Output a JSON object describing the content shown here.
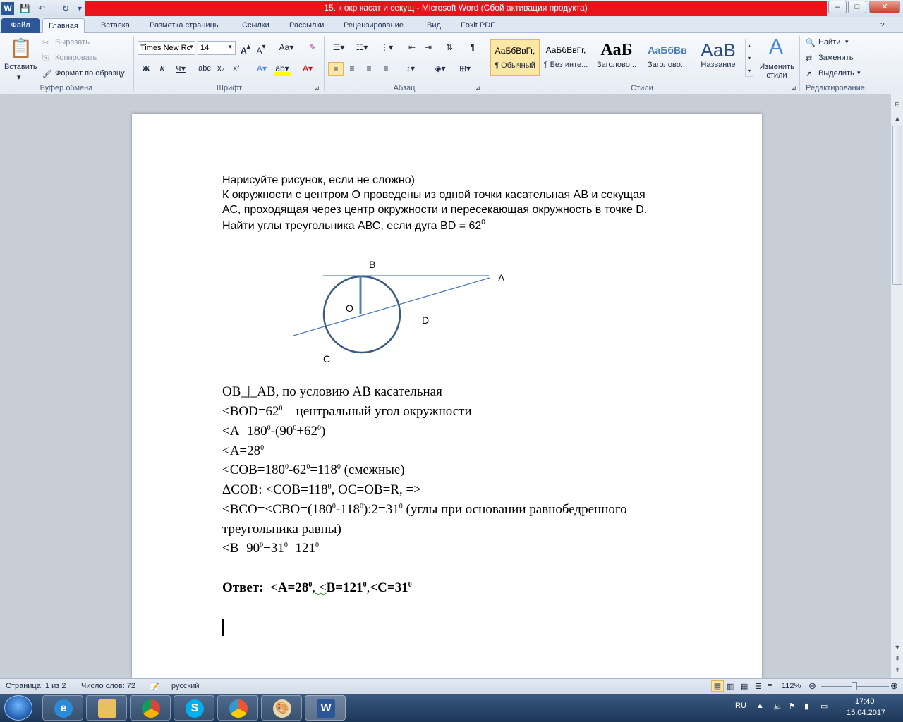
{
  "titlebar": {
    "title": "15. к окр касат и секущ  -  Microsoft Word (Сбой активации продукта)",
    "minimize": "–",
    "maximize": "□",
    "close": "✕"
  },
  "tabs": [
    "Файл",
    "Главная",
    "Вставка",
    "Разметка страницы",
    "Ссылки",
    "Рассылки",
    "Рецензирование",
    "Вид",
    "Foxit PDF"
  ],
  "ribbon": {
    "clipboard": {
      "paste": "Вставить",
      "cut": "Вырезать",
      "copy": "Копировать",
      "format_painter": "Формат по образцу",
      "label": "Буфер обмена"
    },
    "font": {
      "family": "Times New Rc",
      "size": "14",
      "label": "Шрифт"
    },
    "paragraph": {
      "label": "Абзац"
    },
    "styles": {
      "items": [
        {
          "sample": "АаБбВвГг,",
          "name": "¶ Обычный"
        },
        {
          "sample": "АаБбВвГг,",
          "name": "¶ Без инте..."
        },
        {
          "sample": "АаБ",
          "name": "Заголово..."
        },
        {
          "sample": "АаБбВв",
          "name": "Заголово..."
        },
        {
          "sample": "АаВ",
          "name": "Название"
        }
      ],
      "change": "Изменить стили",
      "label": "Стили"
    },
    "editing": {
      "find": "Найти",
      "replace": "Заменить",
      "select": "Выделить",
      "label": "Редактирование"
    }
  },
  "document": {
    "task": [
      "Нарисуйте рисунок, если не сложно)",
      "К окружности с центром О проведены из одной точки касательная АВ и секущая",
      "АС, проходящая через центр окружности и пересекающая окружность в точке D.",
      "Найти углы треугольника АВС, если дуга BD = 62"
    ],
    "figure_labels": {
      "B": "B",
      "A": "A",
      "O": "O",
      "D": "D",
      "C": "C"
    },
    "solution": [
      "OB_|_AB, по условию АВ касательная",
      "<BOD=62",
      "<A=180",
      "<A=28",
      "<COB=180",
      "ΔCOB: <COB=118",
      "<BCO=<CBO=(180",
      "треугольника равны)",
      "<B=90"
    ],
    "answer_prefix": "Ответ:",
    "answer": "<A=28",
    "sup0": "0"
  },
  "statusbar": {
    "page": "Страница: 1 из 2",
    "words": "Число слов: 72",
    "language": "русский",
    "zoom": "112%"
  },
  "taskbar": {
    "lang": "RU",
    "time": "17:40",
    "date": "15.04.2017"
  }
}
